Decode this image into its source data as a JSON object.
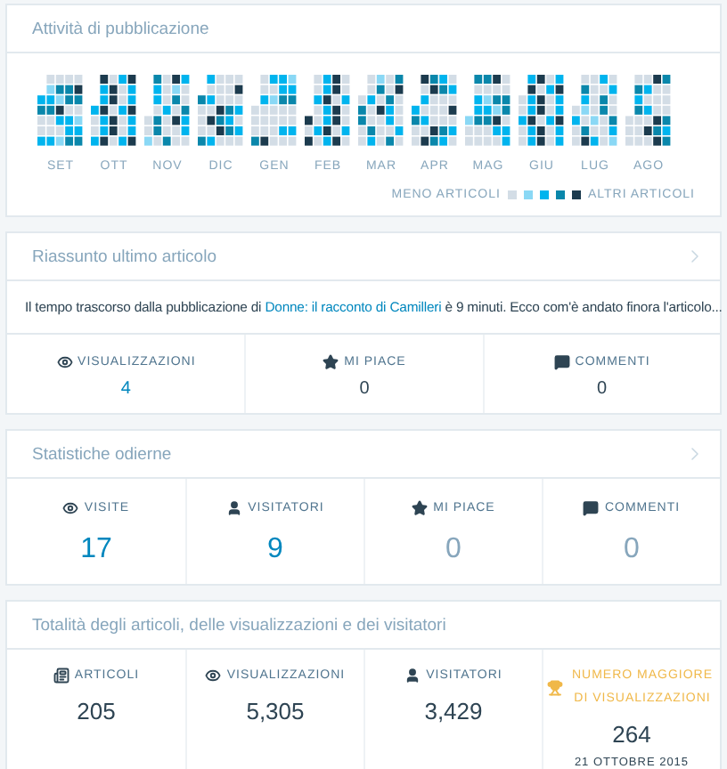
{
  "activity": {
    "title": "Attività di pubblicazione",
    "has_arrow": false,
    "months": [
      {
        "label": "SET"
      },
      {
        "label": "OTT"
      },
      {
        "label": "NOV"
      },
      {
        "label": "DIC"
      },
      {
        "label": "GEN"
      },
      {
        "label": "FEB"
      },
      {
        "label": "MAR"
      },
      {
        "label": "APR"
      },
      {
        "label": "MAG"
      },
      {
        "label": "GIU"
      },
      {
        "label": "LUG"
      },
      {
        "label": "AGO"
      }
    ],
    "legend": {
      "less_label": "MENO ARTICOLI",
      "more_label": "ALTRI ARTICOLI",
      "swatches": [
        {
          "color": "#d3dde6"
        },
        {
          "color": "#8ad8f5"
        },
        {
          "color": "#00b4ee"
        },
        {
          "color": "#0a87ab"
        },
        {
          "color": "#1c3b4e"
        }
      ]
    }
  },
  "latest_post": {
    "title": "Riassunto ultimo articolo",
    "has_arrow": true,
    "summary_start": "Il tempo trascorso dalla pubblicazione di ",
    "summary_link": "Donne: il racconto di Camilleri",
    "summary_end": " è 9 minuti. Ecco com'è andato finora l'articolo...",
    "stats": [
      {
        "kind": "views",
        "label": "VISUALIZZAZIONI",
        "value": "4",
        "highlighted": true,
        "dimmed": false
      },
      {
        "kind": "likes",
        "label": "MI PIACE",
        "value": "0",
        "highlighted": false,
        "dimmed": false
      },
      {
        "kind": "comments",
        "label": "COMMENTI",
        "value": "0",
        "highlighted": false,
        "dimmed": false
      }
    ]
  },
  "today": {
    "title": "Statistiche odierne",
    "has_arrow": true,
    "stats": [
      {
        "kind": "views",
        "label": "VISITE",
        "value": "17",
        "highlighted": true,
        "dimmed": false
      },
      {
        "kind": "visitors",
        "label": "VISITATORI",
        "value": "9",
        "highlighted": true,
        "dimmed": false
      },
      {
        "kind": "likes",
        "label": "MI PIACE",
        "value": "0",
        "highlighted": false,
        "dimmed": true
      },
      {
        "kind": "comments",
        "label": "COMMENTI",
        "value": "0",
        "highlighted": false,
        "dimmed": true
      }
    ]
  },
  "totals": {
    "title": "Totalità degli articoli, delle visualizzazioni e dei visitatori",
    "has_arrow": false,
    "stats": [
      {
        "kind": "posts",
        "label": "ARTICOLI",
        "value": "205",
        "highlighted": false,
        "dimmed": false
      },
      {
        "kind": "views",
        "label": "VISUALIZZAZIONI",
        "value": "5,305",
        "highlighted": false,
        "dimmed": false
      },
      {
        "kind": "visitors",
        "label": "VISITATORI",
        "value": "3,429",
        "highlighted": false,
        "dimmed": false
      },
      {
        "kind": "best",
        "label": "NUMERO MAGGIORE DI VISUALIZZAZIONI",
        "value": "264",
        "highlighted": false,
        "dimmed": false,
        "date": "21 OTTOBRE 2015"
      }
    ]
  }
}
